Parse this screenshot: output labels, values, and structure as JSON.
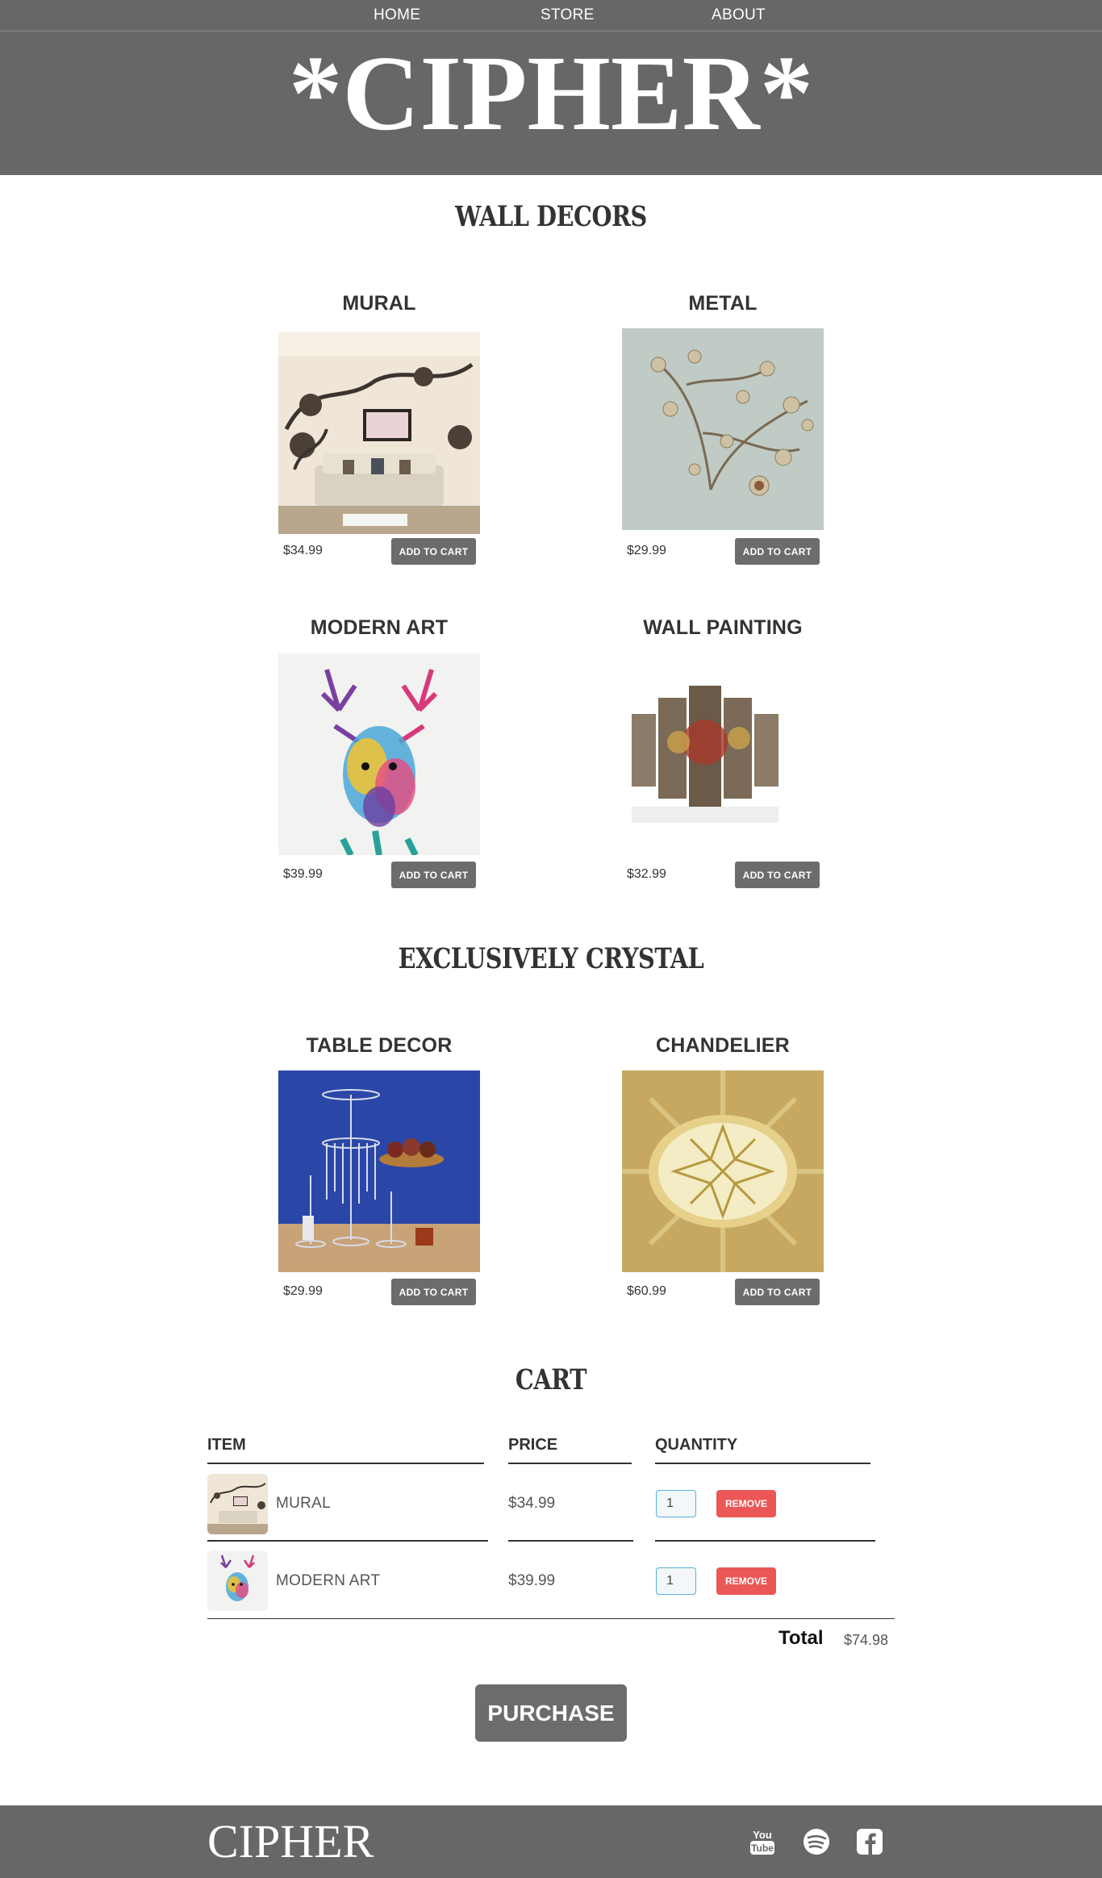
{
  "nav": {
    "home": "HOME",
    "store": "STORE",
    "about": "ABOUT"
  },
  "brand": "*CIPHER*",
  "sections": {
    "wall_decors": "WALL DECORS",
    "crystal": "EXCLUSIVELY CRYSTAL",
    "cart": "CART"
  },
  "items": [
    {
      "title": "MURAL",
      "price": "$34.99",
      "button": "ADD TO CART"
    },
    {
      "title": "METAL",
      "price": "$29.99",
      "button": "ADD TO CART"
    },
    {
      "title": "MODERN ART",
      "price": "$39.99",
      "button": "ADD TO CART"
    },
    {
      "title": "WALL PAINTING",
      "price": "$32.99",
      "button": "ADD TO CART"
    },
    {
      "title": "TABLE DECOR",
      "price": "$29.99",
      "button": "ADD TO CART"
    },
    {
      "title": "CHANDELIER",
      "price": "$60.99",
      "button": "ADD TO CART"
    }
  ],
  "cart": {
    "headers": {
      "item": "ITEM",
      "price": "PRICE",
      "quantity": "QUANTITY"
    },
    "rows": [
      {
        "name": "MURAL",
        "price": "$34.99",
        "quantity": "1",
        "remove": "REMOVE"
      },
      {
        "name": "MODERN ART",
        "price": "$39.99",
        "quantity": "1",
        "remove": "REMOVE"
      }
    ],
    "total_label": "Total",
    "total_value": "$74.98",
    "purchase": "PURCHASE"
  },
  "footer": {
    "brand": "CIPHER",
    "social_icons": [
      "youtube-icon",
      "spotify-icon",
      "facebook-icon"
    ]
  },
  "colors": {
    "header_bg": "#676767",
    "button_bg": "#6c6c6c",
    "remove_bg": "#eb5757",
    "qty_border": "#56b0d6"
  }
}
